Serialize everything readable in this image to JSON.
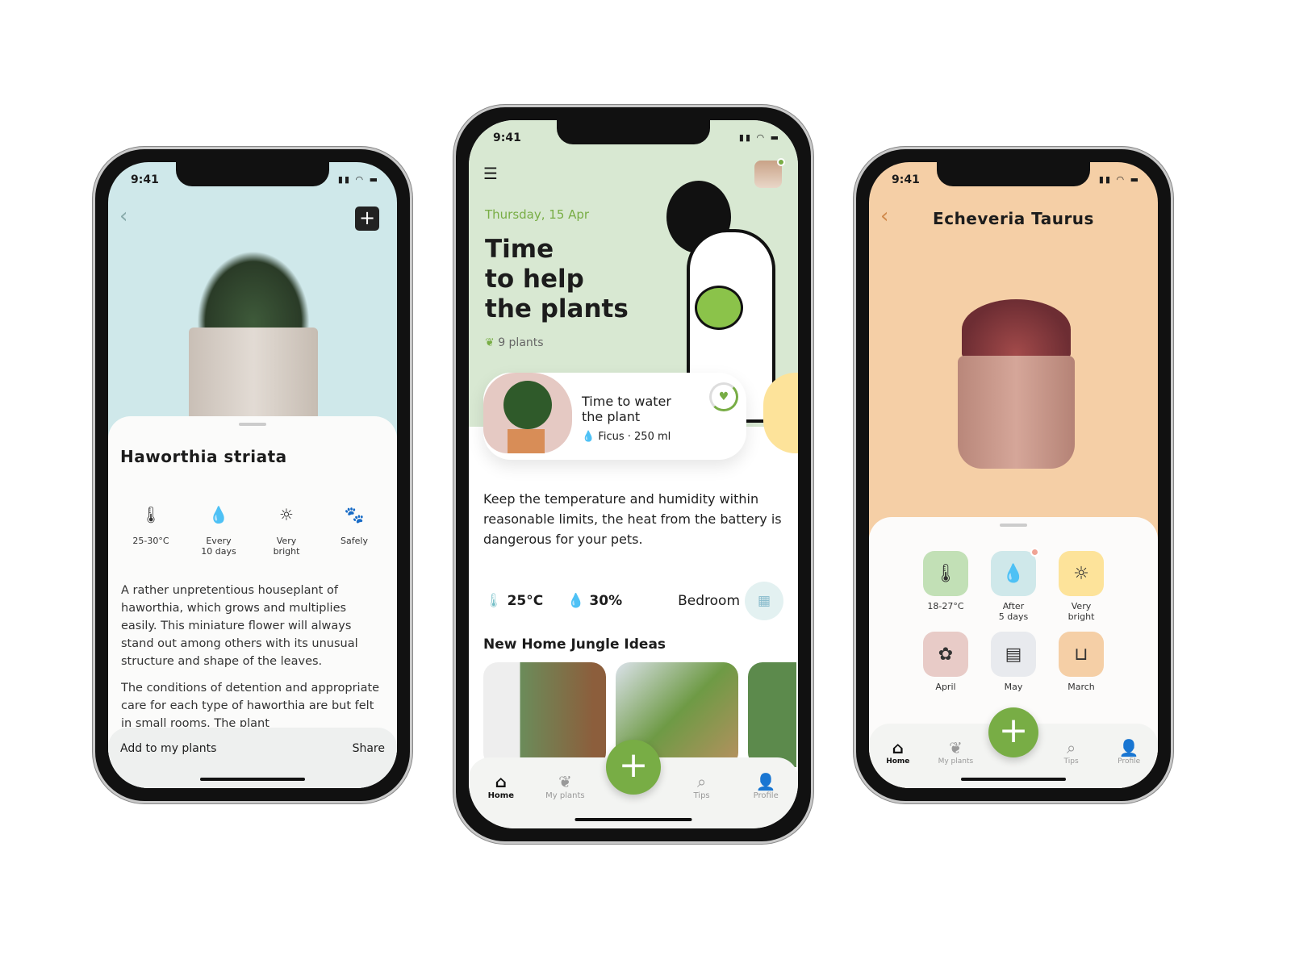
{
  "status_time": "9:41",
  "left": {
    "title": "Haworthia striata",
    "specs": [
      {
        "icon": "thermometer-icon",
        "label": "25-30°C"
      },
      {
        "icon": "water-drop-icon",
        "label": "Every\n10 days"
      },
      {
        "icon": "sun-icon",
        "label": "Very\nbright"
      },
      {
        "icon": "paw-icon",
        "label": "Safely"
      }
    ],
    "paragraphs": [
      "A rather unpretentious houseplant of haworthia, which grows and multiplies easily. This miniature flower will always stand out among others with its unusual structure and shape of the leaves.",
      "The conditions of detention and appropriate care for each type of haworthia are but felt in small rooms. The plant"
    ],
    "add_label": "Add to my plants",
    "share_label": "Share",
    "bg": "#cfe8ea"
  },
  "center": {
    "date": "Thursday, 15 Apr",
    "headline": "Time\nto help\nthe plants",
    "plant_count": "9 plants",
    "card": {
      "title": "Time to water\nthe plant",
      "meta": "Ficus · 250 ml"
    },
    "tip": "Keep the temperature and humidity within reasonable limits, the heat from the battery is dangerous for your pets.",
    "temp": "25°C",
    "humidity": "30%",
    "room": "Bedroom",
    "section_title": "New Home Jungle Ideas",
    "bg": "#d8e8d2",
    "accent": "#78ad45"
  },
  "right": {
    "title": "Echeveria Taurus",
    "tiles": [
      {
        "icon": "thermometer-icon",
        "label": "18-27°C",
        "color": "#c2e0b6"
      },
      {
        "icon": "water-drop-icon",
        "label": "After\n5 days",
        "color": "#cfe8ea"
      },
      {
        "icon": "sun-icon",
        "label": "Very\nbright",
        "color": "#fde39a"
      },
      {
        "icon": "flower-icon",
        "label": "April",
        "color": "#e8cbc7"
      },
      {
        "icon": "fertilizer-icon",
        "label": "May",
        "color": "#e8eaee"
      },
      {
        "icon": "pot-icon",
        "label": "March",
        "color": "#f5cfa6"
      }
    ],
    "bg": "#f5cfa6"
  },
  "tabs": [
    "Home",
    "My plants",
    "Tips",
    "Profile"
  ]
}
